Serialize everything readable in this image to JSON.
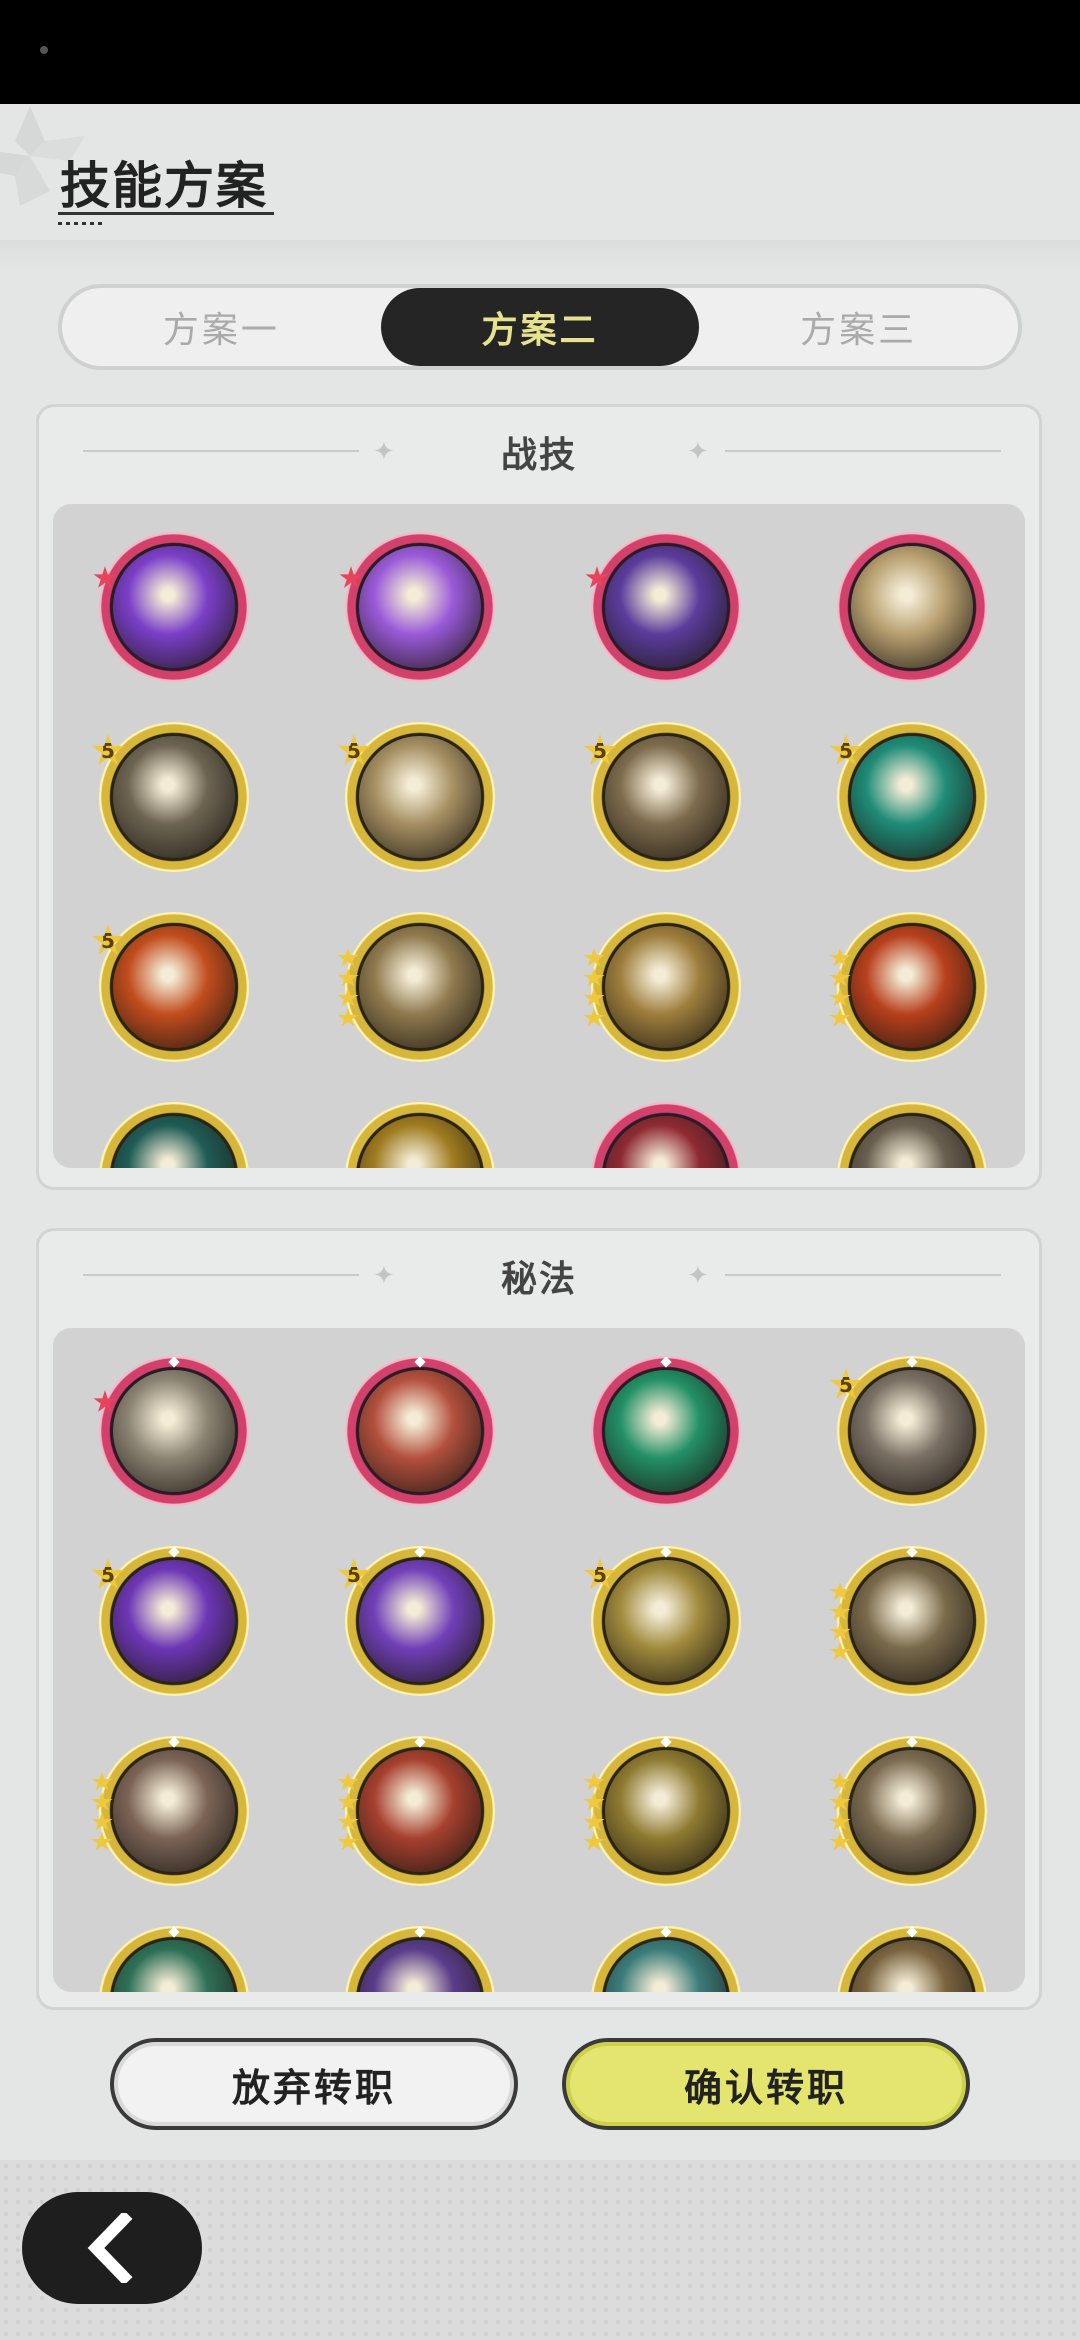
{
  "header": {
    "title": "技能方案"
  },
  "tabs": [
    {
      "label": "方案一",
      "active": false
    },
    {
      "label": "方案二",
      "active": true
    },
    {
      "label": "方案三",
      "active": false
    }
  ],
  "sections": [
    {
      "title": "战技",
      "rows": [
        [
          {
            "icon": "purple-heart-skill-icon",
            "tier": "red",
            "badge": "red-star",
            "color": "#7b3fc8"
          },
          {
            "icon": "purple-rose-skill-icon",
            "tier": "red",
            "badge": "red-star",
            "color": "#9a5ad8"
          },
          {
            "icon": "purple-claw-skill-icon",
            "tier": "red",
            "badge": "red-star",
            "color": "#5b3c9c"
          },
          {
            "icon": "golden-wing-skill-icon",
            "tier": "red",
            "badge": "",
            "color": "#b8a070"
          }
        ],
        [
          {
            "icon": "swirl-skill-icon",
            "tier": "gold",
            "badge": "5",
            "color": "#6d6552"
          },
          {
            "icon": "whirlwind-skill-icon",
            "tier": "gold",
            "badge": "5",
            "color": "#a58f62"
          },
          {
            "icon": "shockwave-skill-icon",
            "tier": "gold",
            "badge": "5",
            "color": "#7d6b4c"
          },
          {
            "icon": "green-sword-skill-icon",
            "tier": "gold",
            "badge": "5",
            "color": "#1f8c78"
          }
        ],
        [
          {
            "icon": "fire-skill-icon",
            "tier": "gold",
            "badge": "5",
            "color": "#c24d1d"
          },
          {
            "icon": "explosion-skill-icon",
            "tier": "gold",
            "badge": "4",
            "color": "#8f7a4e"
          },
          {
            "icon": "slash-skill-icon",
            "tier": "gold",
            "badge": "4",
            "color": "#9e7e3c"
          },
          {
            "icon": "fire-swirl-skill-icon",
            "tier": "gold",
            "badge": "4",
            "color": "#b8401c"
          }
        ],
        [
          {
            "icon": "teal-skill-icon",
            "tier": "gold",
            "badge": "",
            "color": "#1f5c55"
          },
          {
            "icon": "golden-skill-icon",
            "tier": "gold",
            "badge": "",
            "color": "#a07c20"
          },
          {
            "icon": "crimson-skill-icon",
            "tier": "red",
            "badge": "",
            "color": "#8e2a33"
          },
          {
            "icon": "grey-skill-icon",
            "tier": "gold",
            "badge": "",
            "color": "#6a6050"
          }
        ]
      ]
    },
    {
      "title": "秘法",
      "rows": [
        [
          {
            "icon": "leaf-emblem-icon",
            "tier": "red",
            "badge": "red-star",
            "color": "#8c8574"
          },
          {
            "icon": "red-crystal-icon",
            "tier": "red",
            "badge": "",
            "color": "#b3503d"
          },
          {
            "icon": "green-leaf-icon",
            "tier": "red",
            "badge": "",
            "color": "#229066"
          },
          {
            "icon": "sword-shield-icon",
            "tier": "gold",
            "badge": "5",
            "color": "#7a7064"
          }
        ],
        [
          {
            "icon": "purple-flame-icon",
            "tier": "gold",
            "badge": "5",
            "color": "#6d36b5"
          },
          {
            "icon": "purple-figure-icon",
            "tier": "gold",
            "badge": "5",
            "color": "#7040b8"
          },
          {
            "icon": "healing-figure-icon",
            "tier": "gold",
            "badge": "5",
            "color": "#a08a3c"
          },
          {
            "icon": "beast-strike-icon",
            "tier": "gold",
            "badge": "4",
            "color": "#7a6a4c"
          }
        ],
        [
          {
            "icon": "heart-shield-icon",
            "tier": "gold",
            "badge": "4",
            "color": "#7b6456"
          },
          {
            "icon": "red-orb-icon",
            "tier": "gold",
            "badge": "4",
            "color": "#a6402e"
          },
          {
            "icon": "power-figure-icon",
            "tier": "gold",
            "badge": "4",
            "color": "#8e7a30"
          },
          {
            "icon": "armor-icon",
            "tier": "gold",
            "badge": "4",
            "color": "#7c6c52"
          }
        ],
        [
          {
            "icon": "green-orb-icon",
            "tier": "gold",
            "badge": "",
            "color": "#2e7057"
          },
          {
            "icon": "violet-orb-icon",
            "tier": "gold",
            "badge": "",
            "color": "#5a3c8a"
          },
          {
            "icon": "teal-orb-icon",
            "tier": "gold",
            "badge": "",
            "color": "#3a7c7a"
          },
          {
            "icon": "bronze-orb-icon",
            "tier": "gold",
            "badge": "",
            "color": "#7a6440"
          }
        ]
      ]
    }
  ],
  "buttons": {
    "cancel": "放弃转职",
    "confirm": "确认转职"
  },
  "nav": {
    "back_icon": "chevron-left-icon"
  }
}
